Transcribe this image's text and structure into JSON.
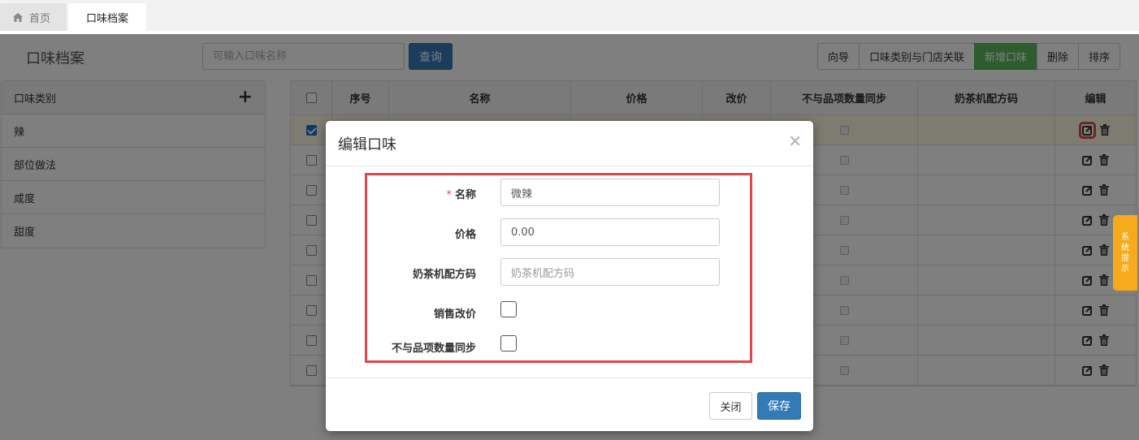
{
  "tabs": {
    "home": "首页",
    "active": "口味档案"
  },
  "header": {
    "title": "口味档案",
    "search_placeholder": "可输入口味名称",
    "query_label": "查询"
  },
  "toolbar": {
    "guide": "向导",
    "link": "口味类别与门店关联",
    "add": "新增口味",
    "delete": "删除",
    "sort": "排序"
  },
  "sidebar": {
    "title": "口味类别",
    "items": [
      "辣",
      "部位做法",
      "咸度",
      "甜度"
    ]
  },
  "table": {
    "headers": [
      "序号",
      "名称",
      "价格",
      "改价",
      "不与品项数量同步",
      "奶茶机配方码",
      "编辑"
    ],
    "row_count": 9
  },
  "systip": {
    "label": [
      "系",
      "统",
      "提",
      "示"
    ]
  },
  "modal": {
    "title": "编辑口味",
    "close_glyph": "×",
    "required_mark": "*",
    "fields": {
      "name_label": "名称",
      "name_value": "微辣",
      "price_label": "价格",
      "price_value": "0.00",
      "code_label": "奶茶机配方码",
      "code_placeholder": "奶茶机配方码",
      "sale_price_label": "销售改价",
      "nosync_label": "不与品项数量同步"
    },
    "close_btn": "关闭",
    "save_btn": "保存"
  },
  "colors": {
    "primary": "#337ab7",
    "success": "#5cb85c",
    "highlight": "#e0474c",
    "tip": "#f5ab1b"
  }
}
